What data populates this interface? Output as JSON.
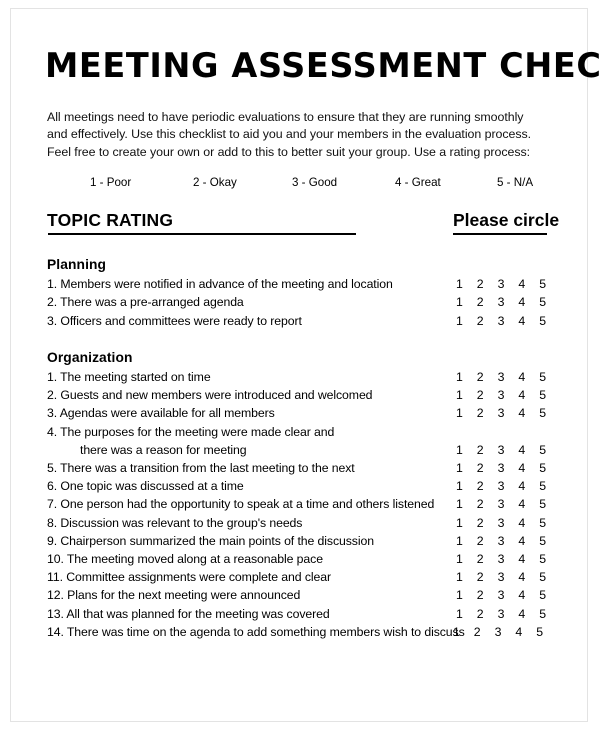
{
  "document": {
    "title": "MEETING ASSESSMENT CHECKLIST",
    "intro": "All meetings need to have periodic evaluations to ensure that they are running smoothly and effectively. Use this checklist to aid you and your members in the evaluation process. Feel free to create your own or add to this to better suit your group. Use a rating process:"
  },
  "rating_scale": [
    {
      "label": "1 - Poor"
    },
    {
      "label": "2 - Okay"
    },
    {
      "label": "3 - Good"
    },
    {
      "label": "4 - Great"
    },
    {
      "label": "5 - N/A"
    }
  ],
  "column_headers": {
    "topic_rating": "TOPIC RATING",
    "please_circle": "Please circle"
  },
  "rating_options": [
    "1",
    "2",
    "3",
    "4",
    "5"
  ],
  "sections": [
    {
      "title": "Planning",
      "items": [
        {
          "text": "1. Members were notified in advance of the meeting and location"
        },
        {
          "text": "2. There was a pre-arranged agenda"
        },
        {
          "text": "3. Officers and committees were ready to report"
        }
      ]
    },
    {
      "title": "Organization",
      "items": [
        {
          "text": "1. The meeting started on time"
        },
        {
          "text": "2. Guests and new members were introduced and welcomed"
        },
        {
          "text": "3. Agendas were available for all members"
        },
        {
          "text": "4. The purposes for the meeting were made clear and",
          "continuation": "there was a reason for meeting"
        },
        {
          "text": "5. There was a transition from the last meeting to the next"
        },
        {
          "text": "6. One topic was discussed at a time"
        },
        {
          "text": "7. One person had the opportunity to speak at a time and others listened"
        },
        {
          "text": "8. Discussion was relevant to the group's needs"
        },
        {
          "text": "9. Chairperson summarized the main points of the discussion"
        },
        {
          "text": "10. The meeting moved along at a reasonable pace"
        },
        {
          "text": "11. Committee assignments were complete and clear"
        },
        {
          "text": "12. Plans for the next meeting were announced"
        },
        {
          "text": "13. All that was planned for the meeting was covered"
        },
        {
          "text": "14. There was time on the agenda to add something members wish to discuss",
          "ratings_shift": true
        }
      ]
    }
  ],
  "scale_positions": [
    43,
    146,
    245,
    348,
    450
  ]
}
